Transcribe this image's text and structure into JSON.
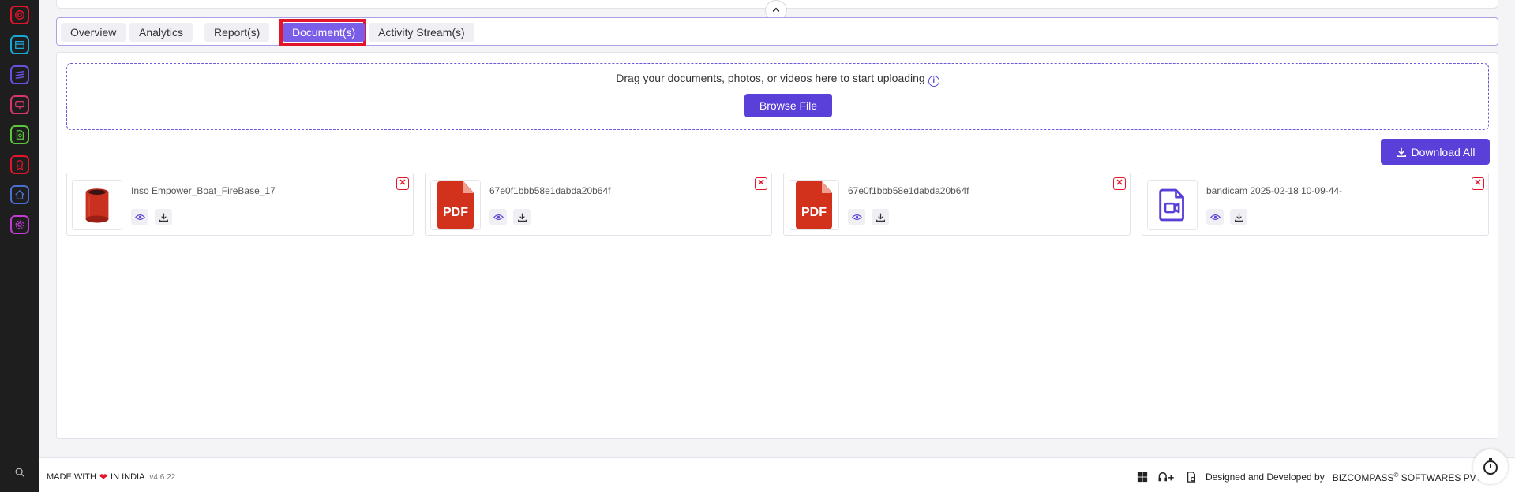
{
  "sidebar": {
    "icons": [
      {
        "name": "target-icon",
        "color": "#e2152a"
      },
      {
        "name": "archive-icon",
        "color": "#1aa7d4"
      },
      {
        "name": "layers-icon",
        "color": "#6a4fe0"
      },
      {
        "name": "monitor-icon",
        "color": "#d8356b"
      },
      {
        "name": "file-icon",
        "color": "#5cc53a"
      },
      {
        "name": "award-icon",
        "color": "#e2152a"
      },
      {
        "name": "home-icon",
        "color": "#4a6fd0"
      },
      {
        "name": "settings-icon",
        "color": "#c23bd4"
      }
    ]
  },
  "tabs": {
    "overview": "Overview",
    "analytics": "Analytics",
    "reports": "Report(s)",
    "documents": "Document(s)",
    "activity": "Activity Stream(s)"
  },
  "upload": {
    "prompt": "Drag your documents, photos, or videos here to start uploading",
    "browse_label": "Browse File"
  },
  "download_all_label": "Download All",
  "documents": [
    {
      "name": "Inso Empower_Boat_FireBase_17",
      "type": "image"
    },
    {
      "name": "67e0f1bbb58e1dabda20b64f",
      "type": "pdf"
    },
    {
      "name": "67e0f1bbb58e1dabda20b64f",
      "type": "pdf"
    },
    {
      "name": "bandicam 2025-02-18 10-09-44-",
      "type": "video"
    }
  ],
  "pdf_label": "PDF",
  "footer": {
    "made_with": "MADE WITH",
    "in_india": "IN INDIA",
    "version": "v4.6.22",
    "designed_by": "Designed and Developed by",
    "company": "BIZCOMPASS",
    "registered": "®",
    "company_suffix": "SOFTWARES PVT."
  },
  "colors": {
    "accent": "#5a3fd8",
    "active_tab": "#7b5ee8",
    "highlight": "#e2152a",
    "pdf": "#d2311c"
  }
}
